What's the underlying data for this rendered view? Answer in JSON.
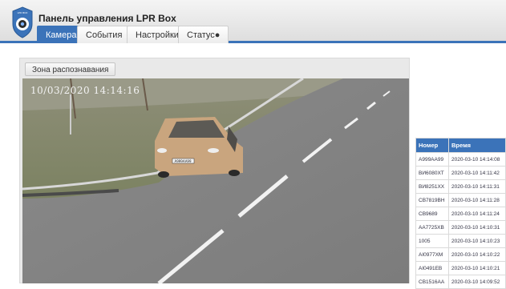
{
  "app": {
    "title": "Панель управления LPR Box",
    "logo_text": "LPR BOX"
  },
  "tabs": [
    {
      "label": "Камера"
    },
    {
      "label": "События"
    },
    {
      "label": "Настройки"
    },
    {
      "label": "Статус●"
    }
  ],
  "camera": {
    "zone_button_label": "Зона распознавания",
    "timestamp": "10/03/2020  14:14:16",
    "plate_text": "A999AA99"
  },
  "table": {
    "headers": [
      "Номер",
      "Время"
    ],
    "rows": [
      [
        "A999AA99",
        "2020-03-10 14:14:08"
      ],
      [
        "BИ6080XT",
        "2020-03-10 14:11:42"
      ],
      [
        "BИ8251XX",
        "2020-03-10 14:11:31"
      ],
      [
        "CB7819BH",
        "2020-03-10 14:11:28"
      ],
      [
        "CB9689",
        "2020-03-10 14:11:24"
      ],
      [
        "AA7725XB",
        "2020-03-10 14:10:31"
      ],
      [
        "1005",
        "2020-03-10 14:10:23"
      ],
      [
        "AI0977XM",
        "2020-03-10 14:10:22"
      ],
      [
        "AI0491EB",
        "2020-03-10 14:10:21"
      ],
      [
        "CB1516AA",
        "2020-03-10 14:09:52"
      ]
    ]
  },
  "colors": {
    "accent": "#3b73b9"
  }
}
